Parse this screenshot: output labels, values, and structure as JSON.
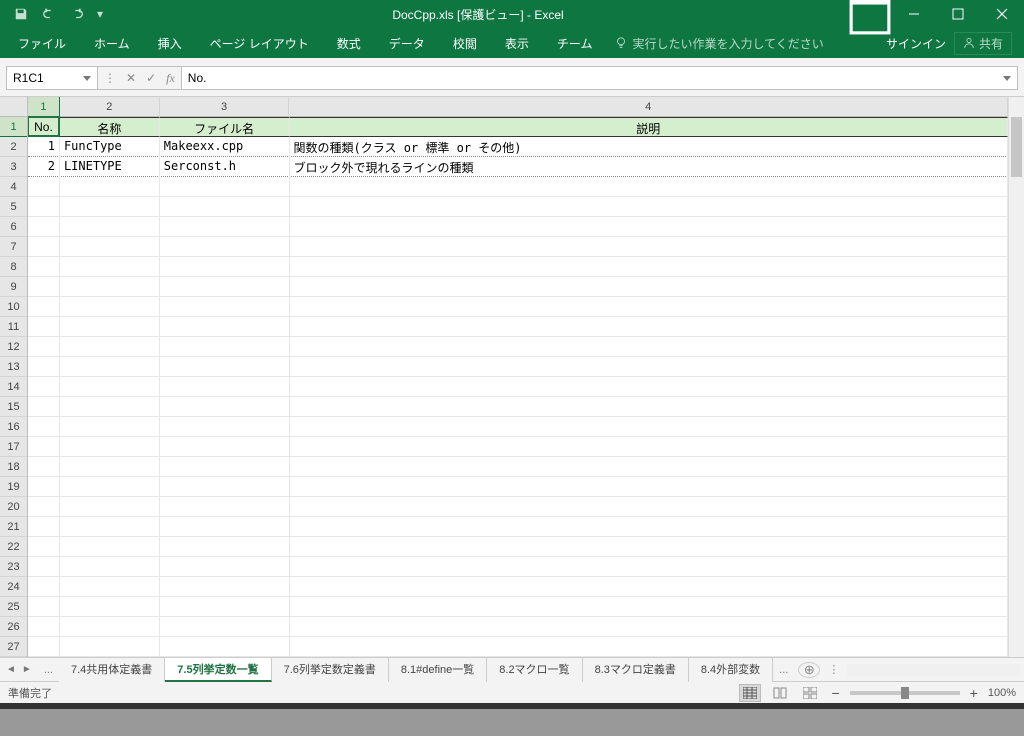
{
  "title": "DocCpp.xls  [保護ビュー] - Excel",
  "ribbon": {
    "file": "ファイル",
    "tabs": [
      "ホーム",
      "挿入",
      "ページ レイアウト",
      "数式",
      "データ",
      "校閲",
      "表示",
      "チーム"
    ],
    "tellme": "実行したい作業を入力してください",
    "signin": "サインイン",
    "share": "共有"
  },
  "namebox": "R1C1",
  "formula": "No.",
  "colheads": [
    "1",
    "2",
    "3",
    "4"
  ],
  "rowcount": 27,
  "headers": {
    "no": "No.",
    "name": "名称",
    "file": "ファイル名",
    "desc": "説明"
  },
  "rows": [
    {
      "no": "1",
      "name": "FuncType",
      "file": "Makeexx.cpp",
      "desc": "関数の種類(クラス or 標準 or その他)"
    },
    {
      "no": "2",
      "name": "LINETYPE",
      "file": "Serconst.h",
      "desc": "ブロック外で現れるラインの種類"
    }
  ],
  "sheets": {
    "tabs": [
      "7.4共用体定義書",
      "7.5列挙定数一覧",
      "7.6列挙定数定義書",
      "8.1#define一覧",
      "8.2マクロ一覧",
      "8.3マクロ定義書",
      "8.4外部変数"
    ],
    "active": 1,
    "ellipsis_right": "..."
  },
  "status": {
    "ready": "準備完了",
    "zoom": "100%"
  }
}
